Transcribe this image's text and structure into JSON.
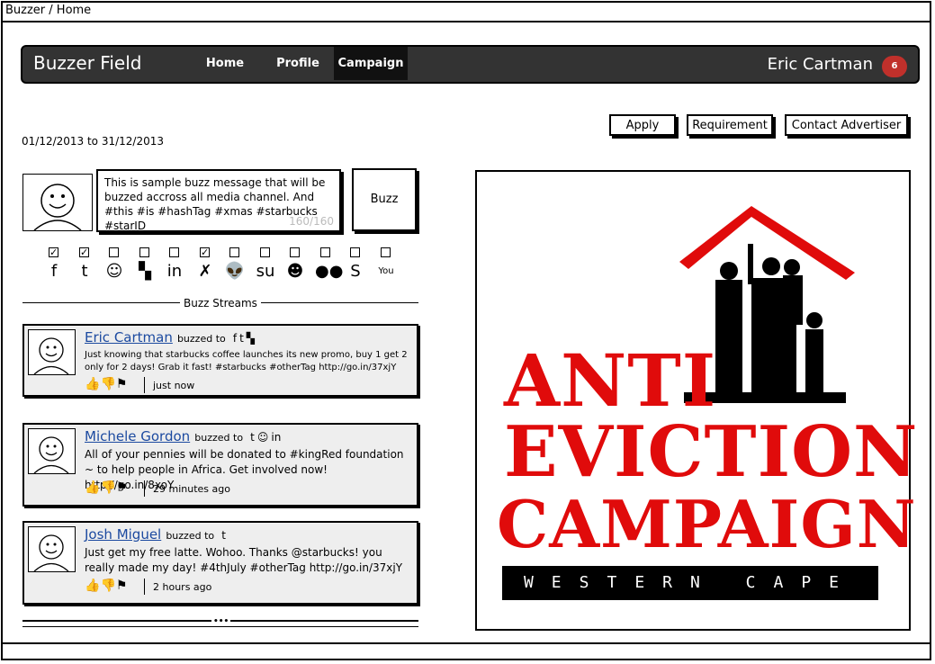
{
  "window": {
    "title": "Buzzer / Home"
  },
  "nav": {
    "brand": "Buzzer Field",
    "items": [
      "Home",
      "Profile",
      "Campaign"
    ],
    "active": "Campaign",
    "user": "Eric Cartman",
    "notifications": "6"
  },
  "actions": {
    "apply": "Apply",
    "requirement": "Requirement",
    "contact": "Contact Advertiser"
  },
  "date_range": "01/12/2013 to 31/12/2013",
  "composer": {
    "message": "This is sample buzz message that will be buzzed accross all media channel. And #this #is #hashTag #xmas #starbucks #starID",
    "counter": "160/160",
    "buzz_button": "Buzz"
  },
  "channels": [
    {
      "icon": "facebook-icon",
      "glyph": "f",
      "checked": true
    },
    {
      "icon": "twitter-icon",
      "glyph": "t",
      "checked": true
    },
    {
      "icon": "blogger-icon",
      "glyph": "☺",
      "checked": false
    },
    {
      "icon": "delicious-icon",
      "glyph": "▚",
      "checked": false
    },
    {
      "icon": "linkedin-icon",
      "glyph": "in",
      "checked": false
    },
    {
      "icon": "xing-icon",
      "glyph": "✗",
      "checked": true
    },
    {
      "icon": "reddit-icon",
      "glyph": "👽",
      "checked": false
    },
    {
      "icon": "stumbleupon-icon",
      "glyph": "su",
      "checked": false
    },
    {
      "icon": "digg-icon",
      "glyph": "☻",
      "checked": false
    },
    {
      "icon": "flickr-icon",
      "glyph": "●●",
      "checked": false
    },
    {
      "icon": "skype-icon",
      "glyph": "S",
      "checked": false
    },
    {
      "icon": "youtube-icon",
      "glyph": "You",
      "checked": false
    }
  ],
  "streams": {
    "label": "Buzz Streams",
    "items": [
      {
        "user": "Eric Cartman",
        "buzzed_to": "buzzed to",
        "channels": [
          "facebook-icon",
          "twitter-icon",
          "delicious-icon"
        ],
        "text": "Just knowing that starbucks coffee launches its new promo, buy 1 get 2 only for 2 days! Grab it fast! #starbucks #otherTag http://go.in/37xjY",
        "time": "just now"
      },
      {
        "user": "Michele Gordon",
        "buzzed_to": "buzzed to",
        "channels": [
          "twitter-icon",
          "blogger-icon",
          "linkedin-icon"
        ],
        "text": "All of your pennies will be donated to #kingRed foundation ~ to help people in Africa. Get involved now! http://go.in/8xoY",
        "time": "29 minutes ago"
      },
      {
        "user": "Josh Miguel",
        "buzzed_to": "buzzed to",
        "channels": [
          "twitter-icon"
        ],
        "text": "Just get my free latte. Wohoo. Thanks @starbucks! you really made my day! #4thJuly #otherTag http://go.in/37xjY",
        "time": "2 hours ago"
      }
    ]
  },
  "campaign_image": {
    "line1": "ANTI",
    "line2": "EVICTION",
    "line3": "CAMPAIGN",
    "banner": "WESTERN CAPE",
    "colors": {
      "red": "#e00b0b",
      "black": "#000000"
    }
  }
}
